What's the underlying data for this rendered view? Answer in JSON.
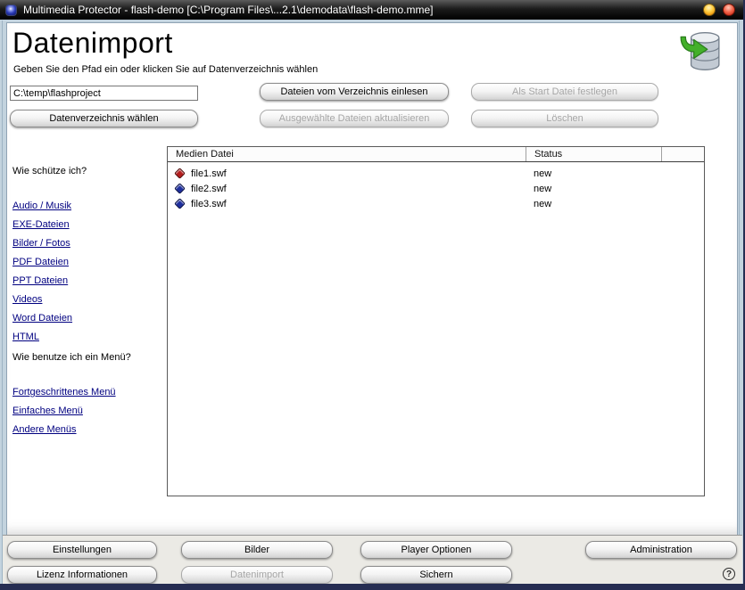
{
  "window": {
    "title": "Multimedia Protector - flash-demo [C:\\Program Files\\...2.1\\demodata\\flash-demo.mme]"
  },
  "header": {
    "title": "Datenimport",
    "subtitle": "Geben Sie den Pfad ein oder klicken Sie auf Datenverzeichnis wählen"
  },
  "toolbar": {
    "path_value": "C:\\temp\\flashproject",
    "choose_dir_label": "Datenverzeichnis wählen",
    "read_files_label": "Dateien vom Verzeichnis einlesen",
    "update_selected_label": "Ausgewählte Dateien aktualisieren",
    "set_start_label": "Als Start Datei festlegen",
    "delete_label": "Löschen"
  },
  "sidebar": {
    "section1": {
      "heading": "Wie schütze ich?",
      "links": [
        "Audio / Musik",
        "EXE-Dateien",
        "Bilder / Fotos",
        "PDF Dateien",
        "PPT Dateien",
        "Videos",
        "Word Dateien",
        "HTML"
      ]
    },
    "section2": {
      "heading": "Wie benutze ich ein Menü?",
      "links": [
        "Fortgeschrittenes Menü",
        "Einfaches Menü",
        "Andere Menüs"
      ]
    }
  },
  "table": {
    "columns": [
      "Medien Datei",
      "Status",
      ""
    ],
    "rows": [
      {
        "file": "file1.swf",
        "status": "new",
        "icon_color": "#b41f1f"
      },
      {
        "file": "file2.swf",
        "status": "new",
        "icon_color": "#1f2f9e"
      },
      {
        "file": "file3.swf",
        "status": "new",
        "icon_color": "#1f2f9e"
      }
    ]
  },
  "footer": {
    "settings_label": "Einstellungen",
    "images_label": "Bilder",
    "player_options_label": "Player Optionen",
    "administration_label": "Administration",
    "license_label": "Lizenz Informationen",
    "dataimport_label": "Datenimport",
    "save_label": "Sichern",
    "help_label": "?"
  },
  "colors": {
    "link": "#000080",
    "titlebar_bg": "#000000",
    "bottom_bar": "#262d52",
    "diamond_red": "#b41f1f",
    "diamond_blue": "#1f2f9e",
    "arrow_green": "#43b02a"
  }
}
